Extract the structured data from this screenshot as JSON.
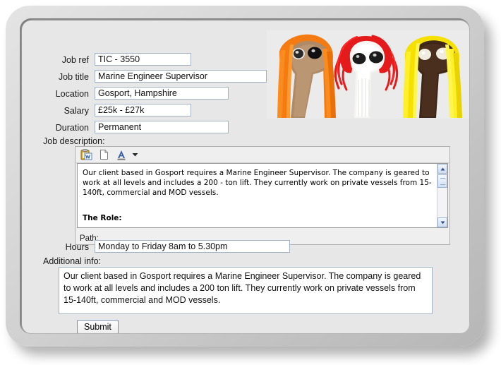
{
  "form": {
    "fields": [
      {
        "label": "Job ref",
        "value": "TIC - 3550"
      },
      {
        "label": "Job title",
        "value": "Marine Engineer Supervisor"
      },
      {
        "label": "Location",
        "value": "Gosport, Hampshire"
      },
      {
        "label": "Salary",
        "value": "£25k - £27k"
      },
      {
        "label": "Duration",
        "value": "Permanent"
      }
    ],
    "job_description_label": "Job description:",
    "hours": {
      "label": "Hours",
      "value": "Monday to Friday 8am to 5.30pm"
    },
    "additional_info_label": "Additional info:",
    "additional_info_value": "Our client based in Gosport requires a Marine Engineer Supervisor. The company is geared to work at all levels and includes a 200 ton lift. They currently work on private vessels from 15-140ft, commercial and MOD vessels.",
    "submit_label": "Submit"
  },
  "editor": {
    "toolbar": [
      {
        "icon": "paste-from-word-icon",
        "title": "Paste from Word"
      },
      {
        "icon": "new-document-icon",
        "title": "New document"
      },
      {
        "icon": "text-color-icon",
        "title": "Text colour"
      },
      {
        "icon": "chevron-down-icon",
        "title": "More colours"
      }
    ],
    "content_paragraph": "Our client based in Gosport requires a Marine Engineer Supervisor. The company is geared to work at all levels and includes a 200 - ton lift. They currently work on private vessels from 15-140ft, commercial and MOD vessels.",
    "content_heading": "The Role:",
    "status_label": "Path:",
    "scrollbar": {
      "up_arrow": "▲",
      "down_arrow": "▼"
    }
  },
  "photo": {
    "name": "sock-puppets-photo",
    "alt": "Three knitted sock puppets with orange, red and yellow wool hair",
    "puppets": [
      {
        "body_color": "#b08a66",
        "hair_color": "#f47b12"
      },
      {
        "body_color": "#f5f3f0",
        "hair_color": "#e51a1a"
      },
      {
        "body_color": "#4a2f1e",
        "hair_color": "#f5e000"
      }
    ],
    "background_color": "#ebebeb"
  },
  "theme": {
    "page_background": "#e7e7e7",
    "bezel_color": "#cfcfcf",
    "input_border": "#a3b3c6",
    "text_color": "#1a1a1a"
  }
}
